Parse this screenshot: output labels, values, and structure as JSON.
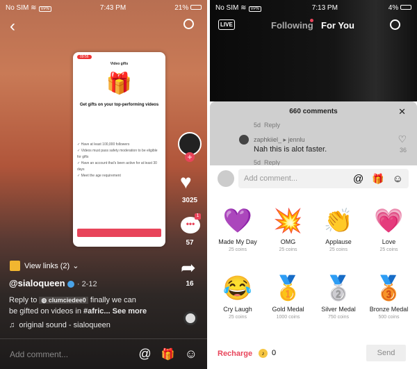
{
  "left": {
    "status": {
      "carrier": "No SIM",
      "vpn": "VPN",
      "time": "7:43 PM",
      "battery": "21%"
    },
    "embedded_screen": {
      "time": "09:56",
      "title": "Video gifts",
      "heading": "Get gifts on your top-performing videos",
      "requirements": [
        "Have at least 100,000 followers",
        "Videos must pass safety moderation to be eligible for gifts",
        "Have an account that's been active for at least 30 days",
        "Meet the age requirement"
      ]
    },
    "sidebar": {
      "likes": "3025",
      "comments": "57",
      "comment_badge": "1",
      "shares": "16"
    },
    "view_links": "View links (2)",
    "username": "@sialoqueen",
    "date": "· 2-12",
    "caption": {
      "reply_to": "Reply to",
      "mention": "clumciedee0",
      "text1": "finally we can",
      "text2": "be gifted on videos in",
      "hashtag": "#afric...",
      "see_more": "See more"
    },
    "sound": "original sound - sialoqueen",
    "comment_placeholder": "Add comment..."
  },
  "right": {
    "status": {
      "carrier": "No SIM",
      "vpn": "VPN",
      "time": "7:13 PM",
      "battery": "4%"
    },
    "header": {
      "live": "LIVE",
      "following": "Following",
      "for_you": "For You"
    },
    "comments": {
      "title": "660 comments",
      "meta1": "5d",
      "reply": "Reply",
      "user": "zaphkiiel_",
      "reply_to_user": "jennlu",
      "text": "Nah this is alot faster.",
      "likes": "36",
      "meta2": "5d"
    },
    "comment_placeholder": "Add comment...",
    "gifts": [
      {
        "name": "Made My Day",
        "price": "25 coins",
        "icon": "💜"
      },
      {
        "name": "OMG",
        "price": "25 coins",
        "icon": "💥"
      },
      {
        "name": "Applause",
        "price": "25 coins",
        "icon": "👏"
      },
      {
        "name": "Love",
        "price": "25 coins",
        "icon": "💗"
      },
      {
        "name": "Cry Laugh",
        "price": "25 coins",
        "icon": "😂"
      },
      {
        "name": "Gold Medal",
        "price": "1000 coins",
        "icon": "🥇"
      },
      {
        "name": "Silver Medal",
        "price": "750 coins",
        "icon": "🥈"
      },
      {
        "name": "Bronze Medal",
        "price": "500 coins",
        "icon": "🥉"
      }
    ],
    "recharge": "Recharge",
    "coins": "0",
    "send": "Send",
    "colors": {
      "accent": "#e8445a",
      "coin": "#f5c542"
    }
  }
}
